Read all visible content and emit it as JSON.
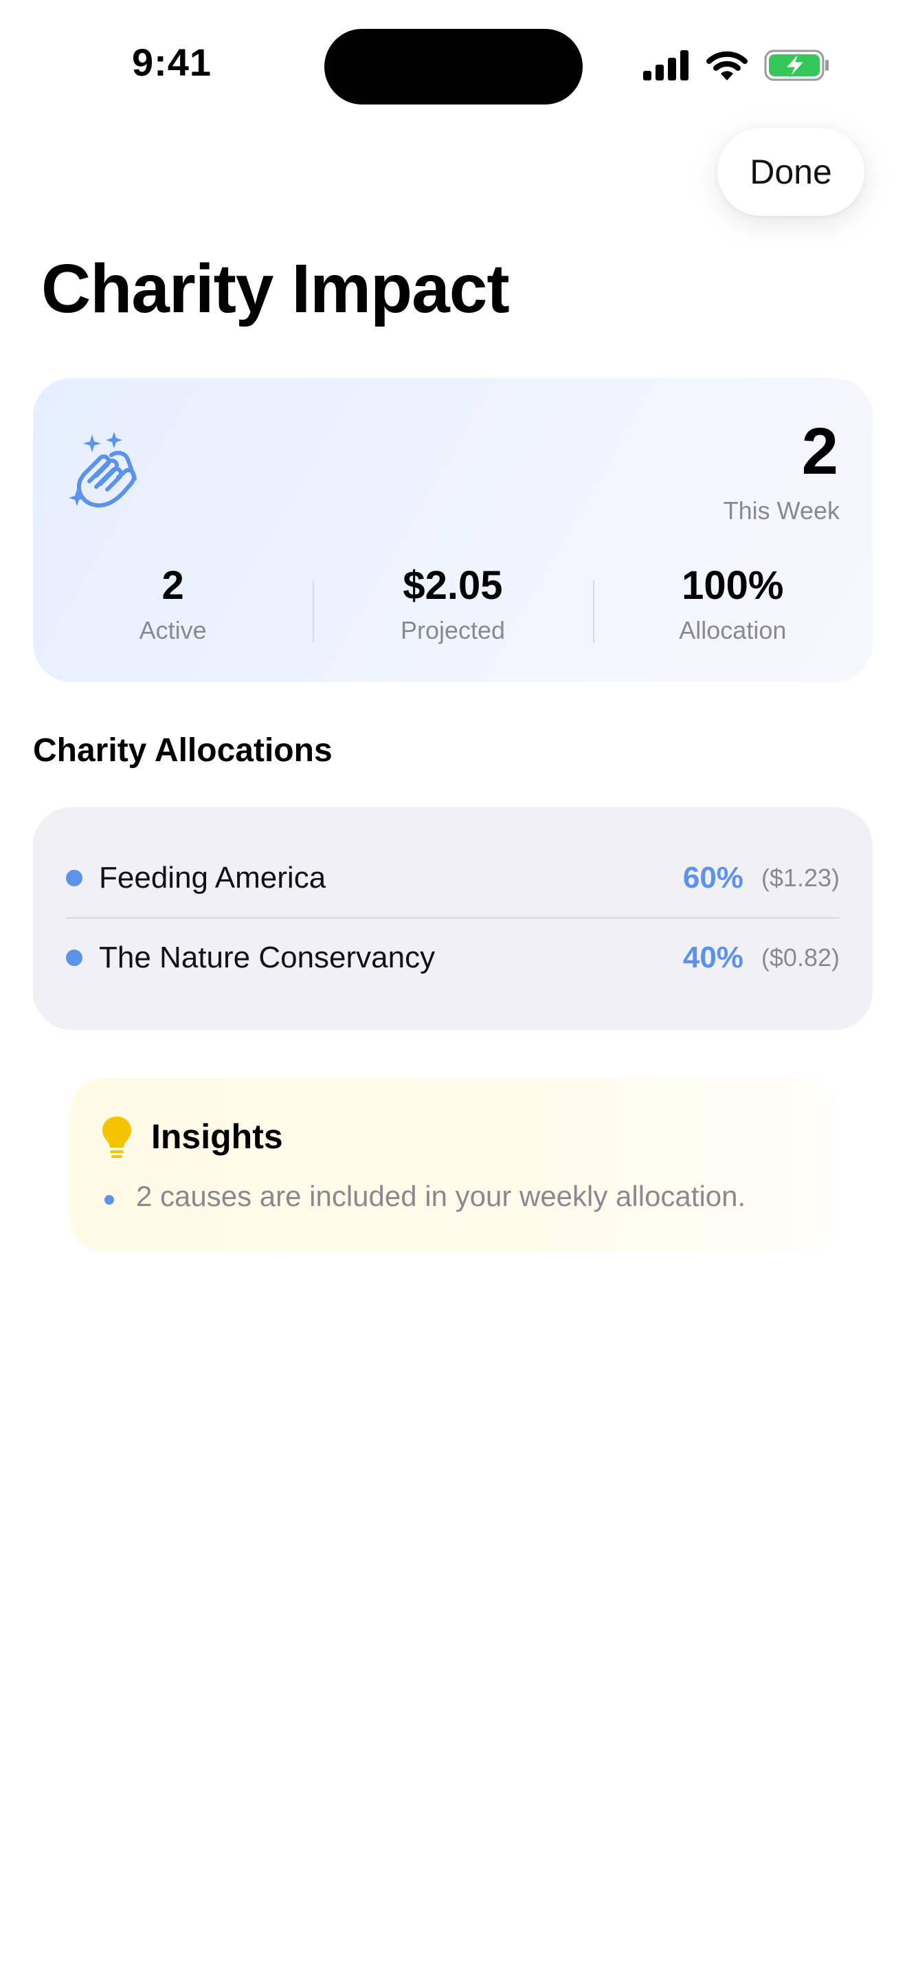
{
  "status_bar": {
    "time": "9:41",
    "icons": [
      "cellular-signal-icon",
      "wifi-icon",
      "battery-charging-icon"
    ]
  },
  "header": {
    "done_label": "Done",
    "title": "Charity Impact"
  },
  "summary": {
    "icon": "hands-clapping-sparkles-icon",
    "weekly_count": "2",
    "weekly_label": "This Week",
    "stats": [
      {
        "value": "2",
        "label": "Active"
      },
      {
        "value": "$2.05",
        "label": "Projected"
      },
      {
        "value": "100%",
        "label": "Allocation"
      }
    ]
  },
  "allocations": {
    "section_title": "Charity Allocations",
    "items": [
      {
        "name": "Feeding America",
        "percent": "60%",
        "amount": "($1.23)"
      },
      {
        "name": "The Nature Conservancy",
        "percent": "40%",
        "amount": "($0.82)"
      }
    ]
  },
  "insights": {
    "icon": "lightbulb-icon",
    "title": "Insights",
    "items": [
      "2 causes are included in your weekly allocation."
    ]
  },
  "colors": {
    "accent": "#5b93ea",
    "secondary_text": "#8a8a8e",
    "battery_green": "#34c759",
    "bulb_yellow": "#f5c400"
  }
}
